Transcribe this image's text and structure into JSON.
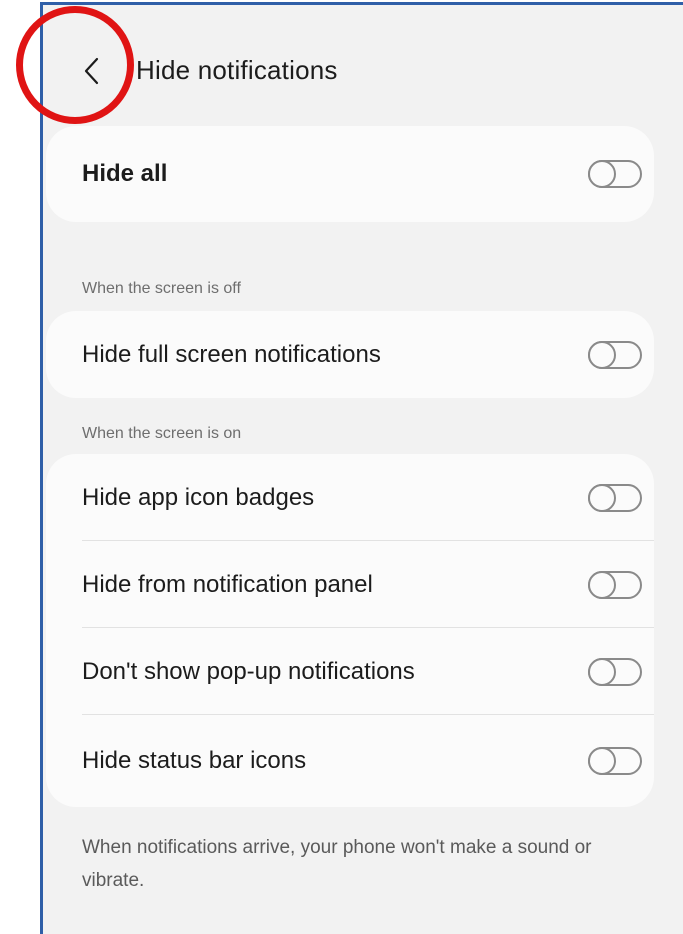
{
  "header": {
    "title": "Hide notifications",
    "back_icon": "chevron-left-icon"
  },
  "hide_all": {
    "label": "Hide all",
    "enabled": false
  },
  "section_screen_off": {
    "header": "When the screen is off",
    "items": [
      {
        "label": "Hide full screen notifications",
        "enabled": false
      }
    ]
  },
  "section_screen_on": {
    "header": "When the screen is on",
    "items": [
      {
        "label": "Hide app icon badges",
        "enabled": false
      },
      {
        "label": "Hide from notification panel",
        "enabled": false
      },
      {
        "label": "Don't show pop-up notifications",
        "enabled": false
      },
      {
        "label": "Hide status bar icons",
        "enabled": false
      }
    ]
  },
  "footnote": "When notifications arrive, your phone won't make a sound or vibrate.",
  "colors": {
    "background": "#f2f2f2",
    "card": "#fbfbfb",
    "annotation_circle": "#e01414",
    "frame_border": "#2f5fa8",
    "toggle_off": "#8a8a8a"
  }
}
